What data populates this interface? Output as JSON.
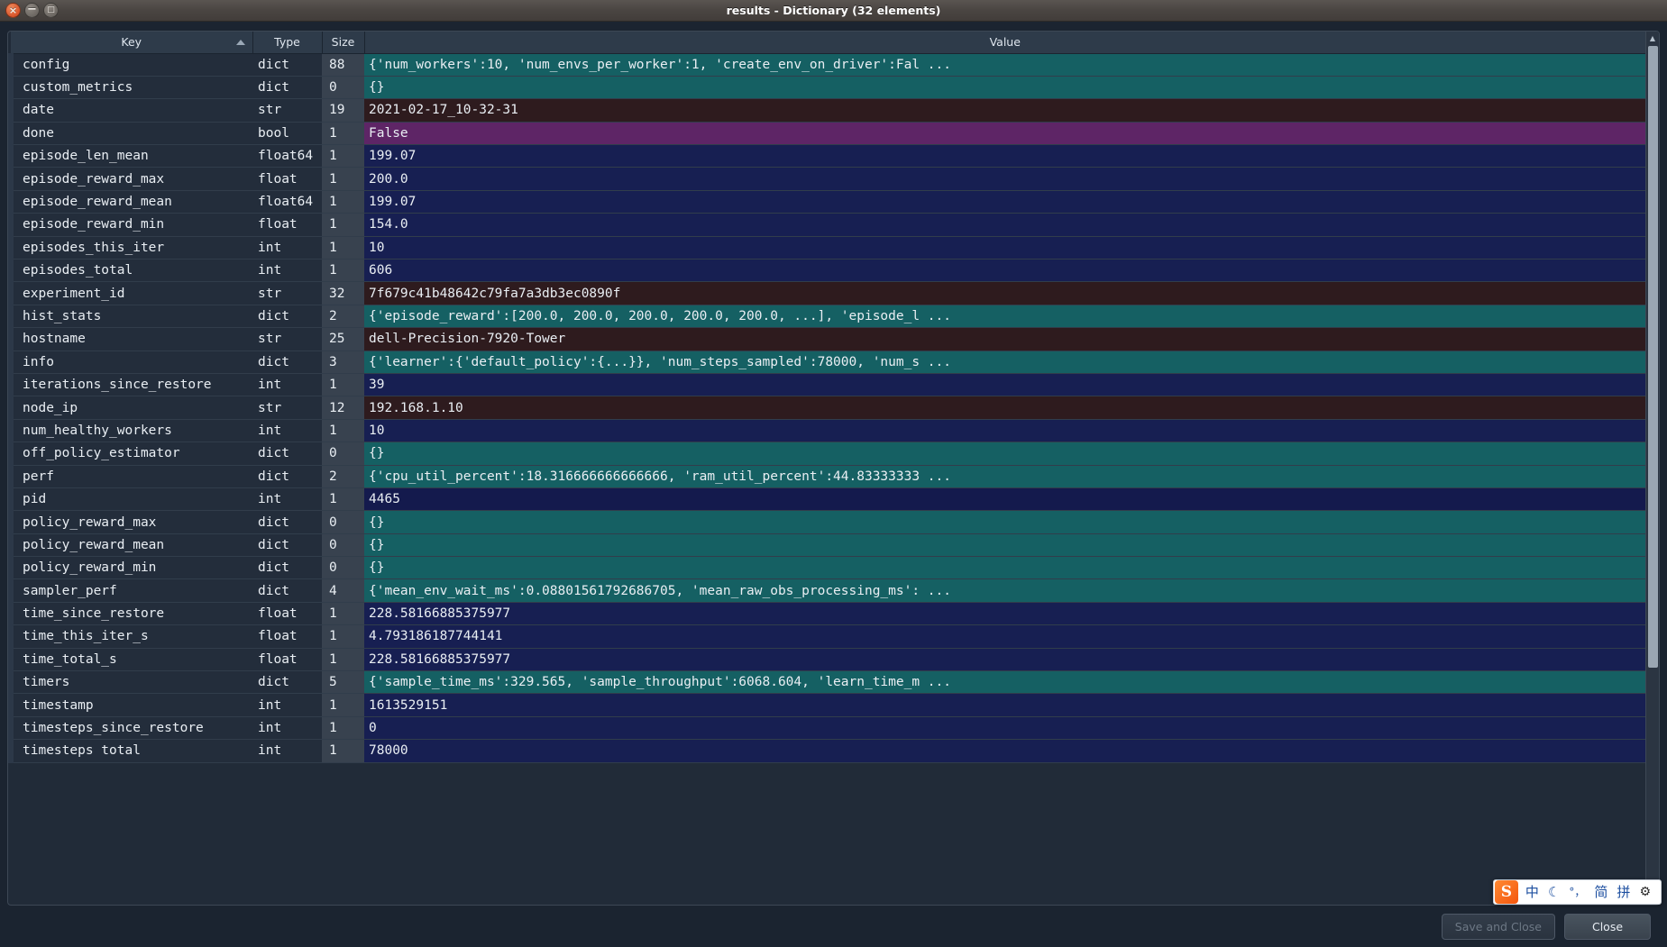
{
  "window": {
    "title": "results - Dictionary (32 elements)",
    "controls": [
      {
        "name": "close",
        "glyph": "×"
      },
      {
        "name": "minimize",
        "glyph": "−"
      },
      {
        "name": "maximize",
        "glyph": "□"
      }
    ]
  },
  "table": {
    "columns": [
      "Key",
      "Type",
      "Size",
      "Value"
    ],
    "sort": {
      "column": "Key",
      "direction": "ascending"
    },
    "rows": [
      {
        "key": "config",
        "type": "dict",
        "size": "88",
        "value": "{'num_workers':10, 'num_envs_per_worker':1, 'create_env_on_driver':Fal ...",
        "style": "dict"
      },
      {
        "key": "custom_metrics",
        "type": "dict",
        "size": "0",
        "value": "{}",
        "style": "dict"
      },
      {
        "key": "date",
        "type": "str",
        "size": "19",
        "value": "2021-02-17_10-32-31",
        "style": "str"
      },
      {
        "key": "done",
        "type": "bool",
        "size": "1",
        "value": "False",
        "style": "bool"
      },
      {
        "key": "episode_len_mean",
        "type": "float64",
        "size": "1",
        "value": "199.07",
        "style": "num"
      },
      {
        "key": "episode_reward_max",
        "type": "float",
        "size": "1",
        "value": "200.0",
        "style": "num"
      },
      {
        "key": "episode_reward_mean",
        "type": "float64",
        "size": "1",
        "value": "199.07",
        "style": "num"
      },
      {
        "key": "episode_reward_min",
        "type": "float",
        "size": "1",
        "value": "154.0",
        "style": "num"
      },
      {
        "key": "episodes_this_iter",
        "type": "int",
        "size": "1",
        "value": "10",
        "style": "num"
      },
      {
        "key": "episodes_total",
        "type": "int",
        "size": "1",
        "value": "606",
        "style": "num"
      },
      {
        "key": "experiment_id",
        "type": "str",
        "size": "32",
        "value": "7f679c41b48642c79fa7a3db3ec0890f",
        "style": "str"
      },
      {
        "key": "hist_stats",
        "type": "dict",
        "size": "2",
        "value": "{'episode_reward':[200.0, 200.0, 200.0, 200.0, 200.0, ...], 'episode_l ...",
        "style": "dict"
      },
      {
        "key": "hostname",
        "type": "str",
        "size": "25",
        "value": "dell-Precision-7920-Tower",
        "style": "str"
      },
      {
        "key": "info",
        "type": "dict",
        "size": "3",
        "value": "{'learner':{'default_policy':{...}}, 'num_steps_sampled':78000, 'num_s ...",
        "style": "dict"
      },
      {
        "key": "iterations_since_restore",
        "type": "int",
        "size": "1",
        "value": "39",
        "style": "num"
      },
      {
        "key": "node_ip",
        "type": "str",
        "size": "12",
        "value": "192.168.1.10",
        "style": "str"
      },
      {
        "key": "num_healthy_workers",
        "type": "int",
        "size": "1",
        "value": "10",
        "style": "num"
      },
      {
        "key": "off_policy_estimator",
        "type": "dict",
        "size": "0",
        "value": "{}",
        "style": "dict"
      },
      {
        "key": "perf",
        "type": "dict",
        "size": "2",
        "value": "{'cpu_util_percent':18.316666666666666, 'ram_util_percent':44.83333333 ...",
        "style": "dict"
      },
      {
        "key": "pid",
        "type": "int",
        "size": "1",
        "value": "4465",
        "style": "num-sel"
      },
      {
        "key": "policy_reward_max",
        "type": "dict",
        "size": "0",
        "value": "{}",
        "style": "dict"
      },
      {
        "key": "policy_reward_mean",
        "type": "dict",
        "size": "0",
        "value": "{}",
        "style": "dict"
      },
      {
        "key": "policy_reward_min",
        "type": "dict",
        "size": "0",
        "value": "{}",
        "style": "dict"
      },
      {
        "key": "sampler_perf",
        "type": "dict",
        "size": "4",
        "value": "{'mean_env_wait_ms':0.08801561792686705, 'mean_raw_obs_processing_ms': ...",
        "style": "dict"
      },
      {
        "key": "time_since_restore",
        "type": "float",
        "size": "1",
        "value": "228.58166885375977",
        "style": "num"
      },
      {
        "key": "time_this_iter_s",
        "type": "float",
        "size": "1",
        "value": "4.793186187744141",
        "style": "num"
      },
      {
        "key": "time_total_s",
        "type": "float",
        "size": "1",
        "value": "228.58166885375977",
        "style": "num"
      },
      {
        "key": "timers",
        "type": "dict",
        "size": "5",
        "value": "{'sample_time_ms':329.565, 'sample_throughput':6068.604, 'learn_time_m ...",
        "style": "dict"
      },
      {
        "key": "timestamp",
        "type": "int",
        "size": "1",
        "value": "1613529151",
        "style": "num"
      },
      {
        "key": "timesteps_since_restore",
        "type": "int",
        "size": "1",
        "value": "0",
        "style": "num"
      },
      {
        "key": "timesteps total",
        "type": "int",
        "size": "1",
        "value": "78000",
        "style": "num"
      }
    ]
  },
  "footer": {
    "save_and_close_label": "Save and Close",
    "close_label": "Close"
  },
  "ime": {
    "logo": "S",
    "items": [
      "中",
      "☾",
      "°，",
      "简",
      "拼",
      "⚙"
    ]
  },
  "colors": {
    "dict_row": "#156063",
    "str_row": "#2e1b1e",
    "bool_row": "#5e2566",
    "num_row": "#171f52",
    "key_cell": "#232d3b",
    "size_cell": "#38424f",
    "header": "#2e3b4a",
    "window_bg": "#1b2430"
  }
}
